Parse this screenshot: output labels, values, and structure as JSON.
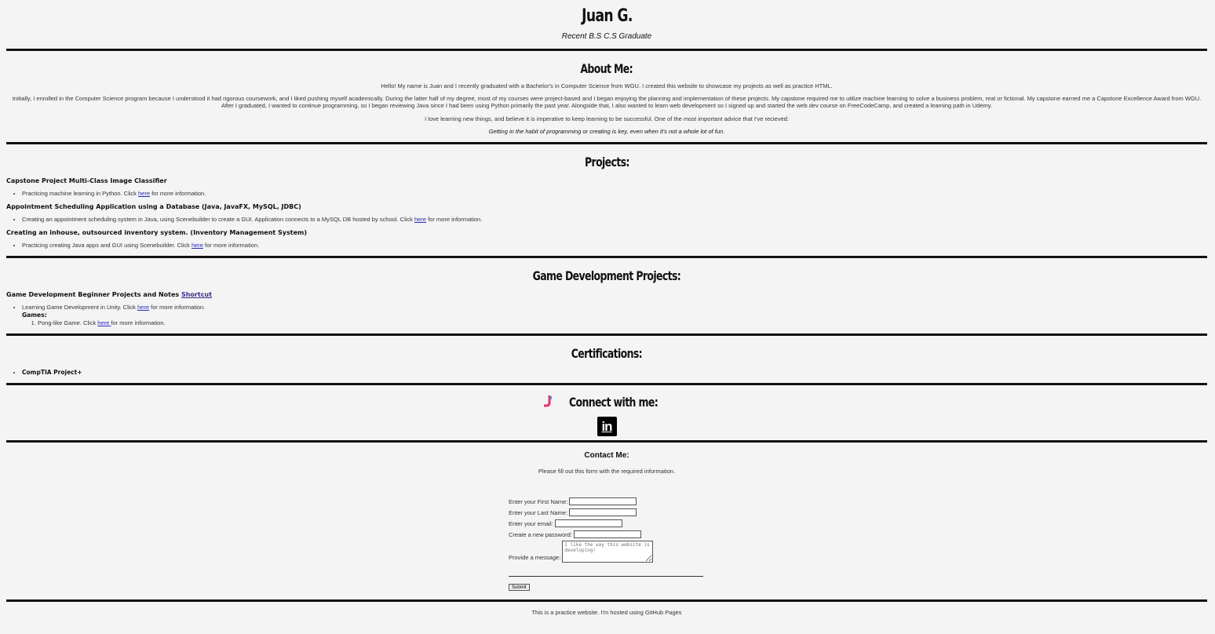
{
  "header": {
    "name": "Juan G.",
    "subtitle": "Recent B.S C.S Graduate"
  },
  "about": {
    "heading": "About Me:",
    "p1": "Hello! My name is Juan and I recently graduated with a Bachelor's in Computer Science from WGU. I created this website to showcase my projects as well as practice HTML.",
    "p2": "Initially, I enrolled in the Computer Science program because I understood it had rigorous coursework, and I liked pushing myself academically. During the latter half of my degree, most of my courses were project-based and I began enjoying the planning and implementation of these projects. My capstone required me to utilize machine learning to solve a business problem, real or fictional. My capstone earned me a Capstone Excellence Award from WGU.",
    "p3": "After I graduated, I wanted to continue programming, so I began reviewing Java since I had been using Python primarily the past year. Alongside that, I also wanted to learn web development so I signed up and started the web dev course on FreeCodeCamp, and created a learning path in Udemy.",
    "p4": "I love learning new things, and believe it is imperative to keep learning to be successful. One of the most important advice that I've recieved:",
    "quote": "Getting in the habit of programming or creating is key, even when it's not a whole lot of fun."
  },
  "projects": {
    "heading": "Projects:",
    "items": [
      {
        "title": "Capstone Project Multi-Class Image Classifier",
        "pre": "Practicing machine learning in Python. Click ",
        "link": "here",
        "post": " for more information."
      },
      {
        "title": "Appointment Scheduling Application using a Database (Java, JavaFX, MySQL, JDBC)",
        "pre": "Creating an appointment scheduling system in Java, using Scenebuilder to create a GUI. Application connects to a MySQL DB hosted by school. Click ",
        "link": "here",
        "post": " for more information."
      },
      {
        "title": "Creating an inhouse, outsourced inventory system. (Inventory Management System)",
        "pre": "Practicing creating Java apps and GUI using Scenebuilder. Click ",
        "link": "here",
        "post": " for more information."
      }
    ]
  },
  "gamedev": {
    "heading": "Game Development Projects:",
    "title": "Game Development Beginner Projects and Notes ",
    "shortcut": "Shortcut",
    "pre": "Learning Game Development in Unity. Click ",
    "link": "here",
    "post": " for more information.",
    "games_label": "Games:",
    "game1_pre": "Pong-like Game. Click ",
    "game1_link": "here ",
    "game1_post": "for more information."
  },
  "certs": {
    "heading": "Certifications:",
    "items": [
      "CompTIA Project+"
    ]
  },
  "connect": {
    "heading": "Connect with me:",
    "linkedin_icon": "linkedin-icon",
    "wave_icon": "wave-hand-icon"
  },
  "contact": {
    "heading": "Contact Me:",
    "instructions": "Please fill out this form with the required information.",
    "first_name_label": "Enter your First Name:",
    "last_name_label": "Enter your Last Name:",
    "email_label": "Enter your email:",
    "password_label": "Create a new password:",
    "message_label": "Provide a message:",
    "message_placeholder": "I like the way this website is developing!",
    "submit_label": "Submit"
  },
  "footer": {
    "text": "This is a practice website. I'm hosted using GitHub Pages"
  },
  "colors": {
    "background": "#f4f4f4",
    "rule": "#111111",
    "link": "#2a2ab8"
  }
}
